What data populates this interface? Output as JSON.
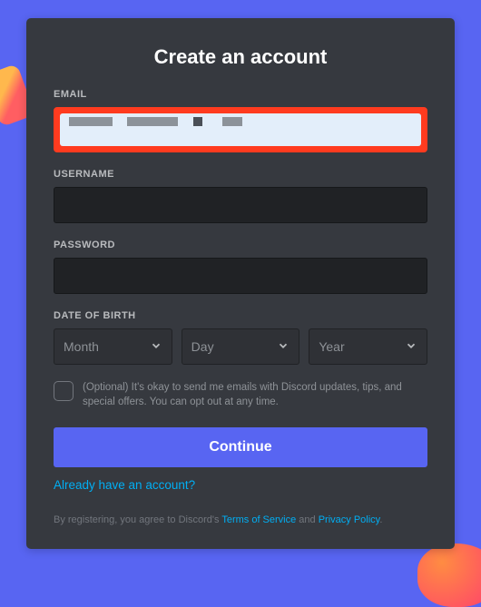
{
  "title": "Create an account",
  "fields": {
    "email": {
      "label": "EMAIL",
      "value": ""
    },
    "username": {
      "label": "USERNAME",
      "value": ""
    },
    "password": {
      "label": "PASSWORD",
      "value": ""
    },
    "dob": {
      "label": "DATE OF BIRTH",
      "month": "Month",
      "day": "Day",
      "year": "Year"
    }
  },
  "optIn": "(Optional) It's okay to send me emails with Discord updates, tips, and special offers. You can opt out at any time.",
  "continue": "Continue",
  "loginLink": "Already have an account?",
  "terms": {
    "prefix": "By registering, you agree to Discord's ",
    "tos": "Terms of Service",
    "and": " and ",
    "privacy": "Privacy Policy",
    "suffix": "."
  },
  "colors": {
    "accent": "#5865F2",
    "cardBg": "#36393F",
    "highlight": "#FF3B1F",
    "link": "#00AFF4"
  }
}
